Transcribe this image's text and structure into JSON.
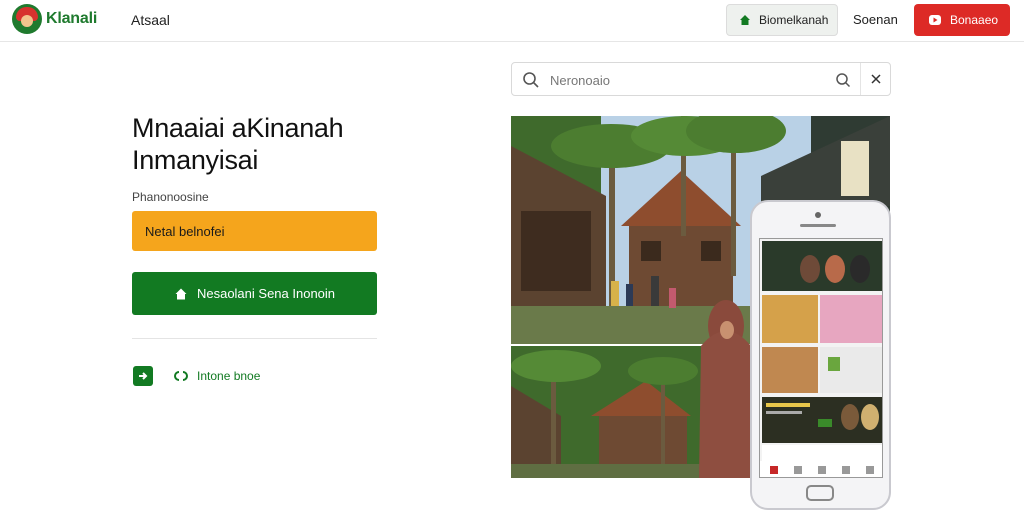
{
  "header": {
    "logo_text": "Klanali",
    "nav_link": "Atsaal",
    "outline_button": "Biomelkanah",
    "signin": "Soenan",
    "red_button": "Bonaaeo"
  },
  "hero": {
    "title_line1": "Mnaaiai aKinanah",
    "title_line2": "Inmanyisai",
    "subtitle": "Phanonoosine",
    "cta_yellow": "Netal belnofei",
    "cta_green": "Nesaolani Sena Inonoin",
    "small_link": "Intone bnoe"
  },
  "search": {
    "placeholder": "Neronoaio"
  },
  "icons": {
    "logo": "logo-icon",
    "outline_button": "house-icon",
    "red_button": "play-icon",
    "cta_green": "house-icon",
    "small_box": "app-icon",
    "small_link": "link-icon",
    "search": "search-icon",
    "search_secondary": "search-icon",
    "close": "close-icon"
  },
  "colors": {
    "brand_green": "#127a22",
    "accent_yellow": "#f5a51c",
    "accent_red": "#dd2a26"
  }
}
